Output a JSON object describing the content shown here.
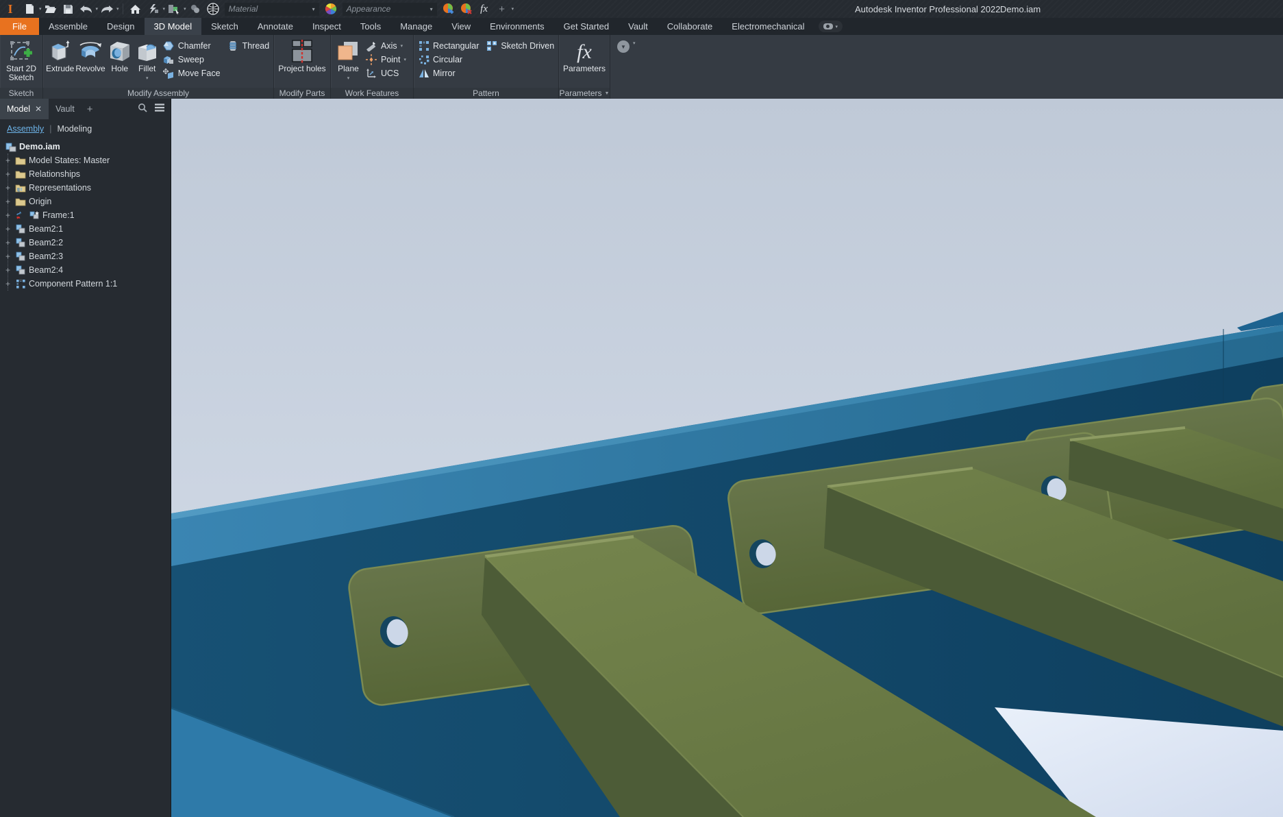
{
  "title_bar": {
    "app_title": "Autodesk Inventor Professional 2022",
    "document_name": "Demo.iam",
    "material_placeholder": "Material",
    "appearance_placeholder": "Appearance"
  },
  "glyphs": {
    "caret_down": "▾",
    "caret_solid": "▼",
    "close_x": "✕",
    "plus": "+",
    "expander": "+",
    "divider": "|",
    "fx": "fx",
    "logo_i": "I"
  },
  "ribbon": {
    "tabs": [
      "File",
      "Assemble",
      "Design",
      "3D Model",
      "Sketch",
      "Annotate",
      "Inspect",
      "Tools",
      "Manage",
      "View",
      "Environments",
      "Get Started",
      "Vault",
      "Collaborate",
      "Electromechanical"
    ],
    "active_tab": "3D Model",
    "panel_labels": {
      "sketch": "Sketch",
      "modify_assembly": "Modify Assembly",
      "modify_parts": "Modify Parts",
      "work_features": "Work Features",
      "pattern": "Pattern",
      "parameters": "Parameters"
    },
    "buttons": {
      "start_2d_sketch": "Start 2D Sketch",
      "extrude": "Extrude",
      "revolve": "Revolve",
      "hole": "Hole",
      "fillet": "Fillet",
      "chamfer": "Chamfer",
      "sweep": "Sweep",
      "move_face": "Move Face",
      "thread": "Thread",
      "project_holes": "Project holes",
      "plane": "Plane",
      "axis": "Axis",
      "point": "Point",
      "ucs": "UCS",
      "rectangular": "Rectangular",
      "circular": "Circular",
      "mirror": "Mirror",
      "sketch_driven": "Sketch Driven",
      "parameters": "Parameters"
    }
  },
  "browser": {
    "tab_model": "Model",
    "tab_vault": "Vault",
    "view_assembly": "Assembly",
    "view_modeling": "Modeling",
    "tree": [
      {
        "label": "Demo.iam",
        "type": "assembly-root"
      },
      {
        "label": "Model States: Master",
        "type": "folder"
      },
      {
        "label": "Relationships",
        "type": "folder"
      },
      {
        "label": "Representations",
        "type": "representations-folder"
      },
      {
        "label": "Origin",
        "type": "folder"
      },
      {
        "label": "Frame:1",
        "type": "frame-generator-component"
      },
      {
        "label": "Beam2:1",
        "type": "part"
      },
      {
        "label": "Beam2:2",
        "type": "part"
      },
      {
        "label": "Beam2:3",
        "type": "part"
      },
      {
        "label": "Beam2:4",
        "type": "part"
      },
      {
        "label": "Component Pattern 1:1",
        "type": "component-pattern"
      }
    ]
  },
  "viewport": {
    "colors": {
      "sky_top": "#bfc9d7",
      "sky_bottom": "#d5dde9",
      "channel_top_face": "#3a85b2",
      "channel_web_dark": "#14496b",
      "channel_flange": "#2e7aa9",
      "beam_top": "#75854d",
      "beam_side": "#4d5c37",
      "plate_face": "#617040",
      "hole_light": "#ccd7e8",
      "ground_white": "#e9f0fa"
    }
  }
}
